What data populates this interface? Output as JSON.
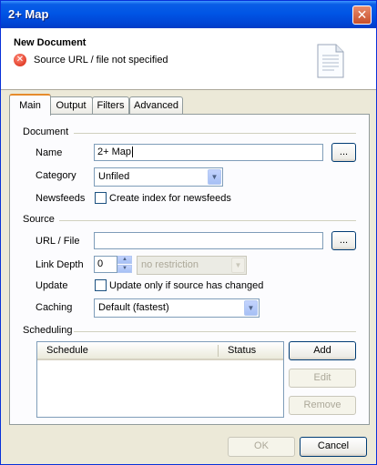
{
  "window": {
    "title": "2+ Map"
  },
  "header": {
    "title": "New Document",
    "error_text": "Source URL / file not specified"
  },
  "tabs": [
    {
      "label": "Main",
      "active": true
    },
    {
      "label": "Output"
    },
    {
      "label": "Filters"
    },
    {
      "label": "Advanced"
    }
  ],
  "document_group": {
    "title": "Document",
    "name_label": "Name",
    "name_value": "2+ Map",
    "browse_label": "...",
    "category_label": "Category",
    "category_value": "Unfiled",
    "newsfeeds_label": "Newsfeeds",
    "newsfeeds_checkbox": "Create index for newsfeeds"
  },
  "source_group": {
    "title": "Source",
    "url_label": "URL / File",
    "url_value": "",
    "browse_label": "...",
    "link_depth_label": "Link Depth",
    "link_depth_value": "0",
    "restriction_value": "no restriction",
    "update_label": "Update",
    "update_checkbox": "Update only if source has changed",
    "caching_label": "Caching",
    "caching_value": "Default (fastest)"
  },
  "scheduling_group": {
    "title": "Scheduling",
    "columns": [
      "Schedule",
      "Status"
    ],
    "add_label": "Add",
    "edit_label": "Edit",
    "remove_label": "Remove"
  },
  "footer": {
    "ok_label": "OK",
    "cancel_label": "Cancel"
  }
}
